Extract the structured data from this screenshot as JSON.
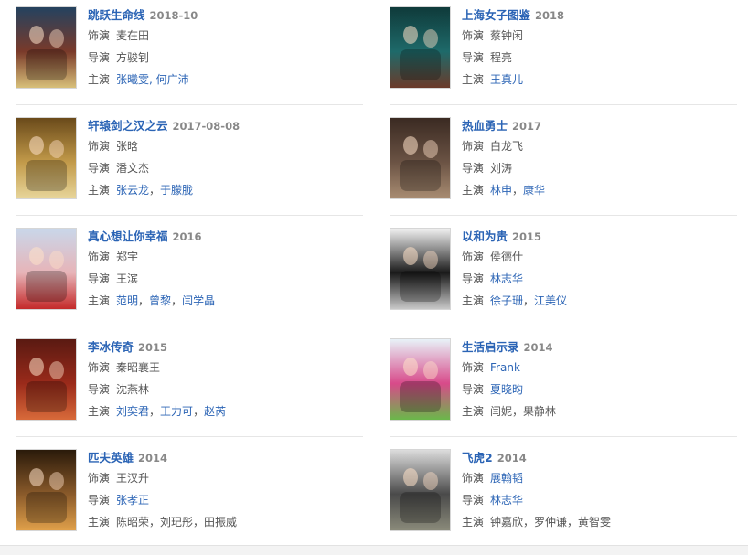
{
  "labels": {
    "role_actor": "饰演",
    "role_director": "导演",
    "role_cast": "主演"
  },
  "items": [
    {
      "title": "跳跃生命线",
      "year": "2018-10",
      "actor": [
        {
          "t": "麦在田",
          "link": false
        }
      ],
      "director": [
        {
          "t": "方骏钊",
          "link": false
        }
      ],
      "cast": [
        {
          "t": "张曦雯, 何广沛",
          "link": true
        }
      ],
      "colors": [
        "#24425f",
        "#7a3a2a",
        "#d8c07a"
      ]
    },
    {
      "title": "上海女子图鉴",
      "year": "2018",
      "actor": [
        {
          "t": "蔡钟闲",
          "link": false
        }
      ],
      "director": [
        {
          "t": "程亮",
          "link": false
        }
      ],
      "cast": [
        {
          "t": "王真儿",
          "link": true
        }
      ],
      "colors": [
        "#0f3a3a",
        "#1e6a6a",
        "#6b3a2a"
      ]
    },
    {
      "title": "轩辕剑之汉之云",
      "year": "2017-08-08",
      "actor": [
        {
          "t": "张晗",
          "link": false
        }
      ],
      "director": [
        {
          "t": "潘文杰",
          "link": false
        }
      ],
      "cast": [
        {
          "t": "张云龙",
          "link": true
        },
        {
          "t": "，",
          "link": false
        },
        {
          "t": "于朦胧",
          "link": true
        }
      ],
      "colors": [
        "#6a4a1a",
        "#c29a4a",
        "#e7d59a"
      ]
    },
    {
      "title": "热血勇士",
      "year": "2017",
      "actor": [
        {
          "t": "白龙飞",
          "link": false
        }
      ],
      "director": [
        {
          "t": "刘涛",
          "link": false
        }
      ],
      "cast": [
        {
          "t": "林申",
          "link": true
        },
        {
          "t": "，",
          "link": false
        },
        {
          "t": "康华",
          "link": true
        }
      ],
      "colors": [
        "#3a2a22",
        "#6b5344",
        "#a88c72"
      ]
    },
    {
      "title": "真心想让你幸福",
      "year": "2016",
      "actor": [
        {
          "t": "郑宇",
          "link": false
        }
      ],
      "director": [
        {
          "t": "王滨",
          "link": false
        }
      ],
      "cast": [
        {
          "t": "范明",
          "link": true
        },
        {
          "t": "，",
          "link": false
        },
        {
          "t": "曾黎",
          "link": true
        },
        {
          "t": "，",
          "link": false
        },
        {
          "t": "闫学晶",
          "link": true
        }
      ],
      "colors": [
        "#c9d7ea",
        "#e7b4b8",
        "#c42a2a"
      ]
    },
    {
      "title": "以和为贵",
      "year": "2015",
      "actor": [
        {
          "t": "侯德仕",
          "link": false
        }
      ],
      "director": [
        {
          "t": "林志华",
          "link": true
        }
      ],
      "cast": [
        {
          "t": "徐子珊",
          "link": true
        },
        {
          "t": "，",
          "link": false
        },
        {
          "t": "江美仪",
          "link": true
        }
      ],
      "colors": [
        "#f2f2f2",
        "#1a1a1a",
        "#c8c8c8"
      ]
    },
    {
      "title": "李冰传奇",
      "year": "2015",
      "actor": [
        {
          "t": "秦昭襄王",
          "link": false
        }
      ],
      "director": [
        {
          "t": "沈燕林",
          "link": false
        }
      ],
      "cast": [
        {
          "t": "刘奕君",
          "link": true
        },
        {
          "t": "，",
          "link": false
        },
        {
          "t": "王力可",
          "link": true
        },
        {
          "t": "，",
          "link": false
        },
        {
          "t": "赵芮",
          "link": true
        }
      ],
      "colors": [
        "#5a1a12",
        "#9a2a1a",
        "#d86a3a"
      ]
    },
    {
      "title": "生活启示录",
      "year": "2014",
      "actor": [
        {
          "t": "Frank",
          "link": true
        }
      ],
      "director": [
        {
          "t": "夏晓昀",
          "link": true
        }
      ],
      "cast": [
        {
          "t": "闫妮，果静林",
          "link": false
        }
      ],
      "colors": [
        "#e8f2f8",
        "#d84a8a",
        "#6ab84a"
      ]
    },
    {
      "title": "匹夫英雄",
      "year": "2014",
      "actor": [
        {
          "t": "王汉升",
          "link": false
        }
      ],
      "director": [
        {
          "t": "张孝正",
          "link": true
        }
      ],
      "cast": [
        {
          "t": "陈昭荣，刘玘彤，田振威",
          "link": false
        }
      ],
      "colors": [
        "#2a1a0a",
        "#8a5a2a",
        "#e0a04a"
      ]
    },
    {
      "title": "飞虎2",
      "year": "2014",
      "actor": [
        {
          "t": "展翰韬",
          "link": true
        }
      ],
      "director": [
        {
          "t": "林志华",
          "link": true
        }
      ],
      "cast": [
        {
          "t": "钟嘉欣，罗仲谦，黄智雯",
          "link": false
        }
      ],
      "colors": [
        "#dcdcdc",
        "#4a4a4a",
        "#8a8a7a"
      ]
    }
  ]
}
